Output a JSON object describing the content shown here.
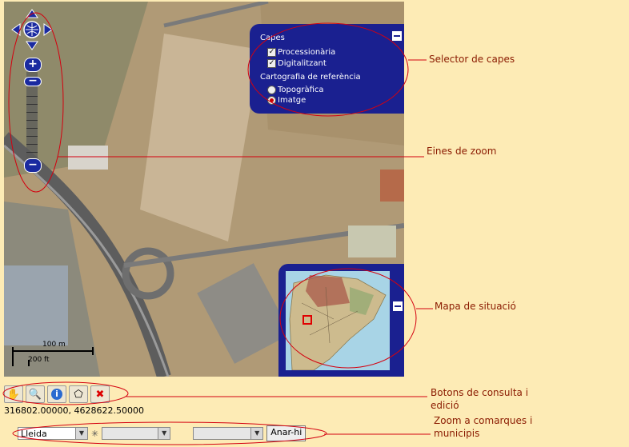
{
  "layers_panel": {
    "title": "Capes",
    "items": [
      {
        "label": "Processionària",
        "checked": true
      },
      {
        "label": "Digitalitzant",
        "checked": true
      }
    ],
    "reference_title": "Cartografia de referència",
    "reference_options": [
      {
        "label": "Topogràfica",
        "selected": false
      },
      {
        "label": "Imatge",
        "selected": true
      }
    ]
  },
  "scale_bar": {
    "metric": "100 m",
    "imperial": "200 ft"
  },
  "coordinates": "316802.00000, 4628622.50000",
  "toolbar": {
    "tools": [
      {
        "name": "pan-hand-icon",
        "glyph": "✋"
      },
      {
        "name": "zoom-magnifier-icon",
        "glyph": "🔍"
      },
      {
        "name": "info-icon",
        "glyph": "ℹ"
      },
      {
        "name": "polygon-icon",
        "glyph": "⬠"
      },
      {
        "name": "delete-icon",
        "glyph": "✖"
      }
    ]
  },
  "zoom_form": {
    "comarca_value": "Lleida",
    "municipi_value": "",
    "extra_value": "",
    "go_label": "Anar-hi"
  },
  "annotations": {
    "layers": "Selector de capes",
    "zoom": "Eines de zoom",
    "overview": "Mapa de situació",
    "query": "Botons de consulta i\nedició",
    "zoom_comarques": "Zoom a comarques i\nmunicipis"
  },
  "colors": {
    "panel": "#1a2090",
    "annotation": "#8a1a00",
    "ellipse": "#d4000f",
    "background": "#fdebb5"
  }
}
